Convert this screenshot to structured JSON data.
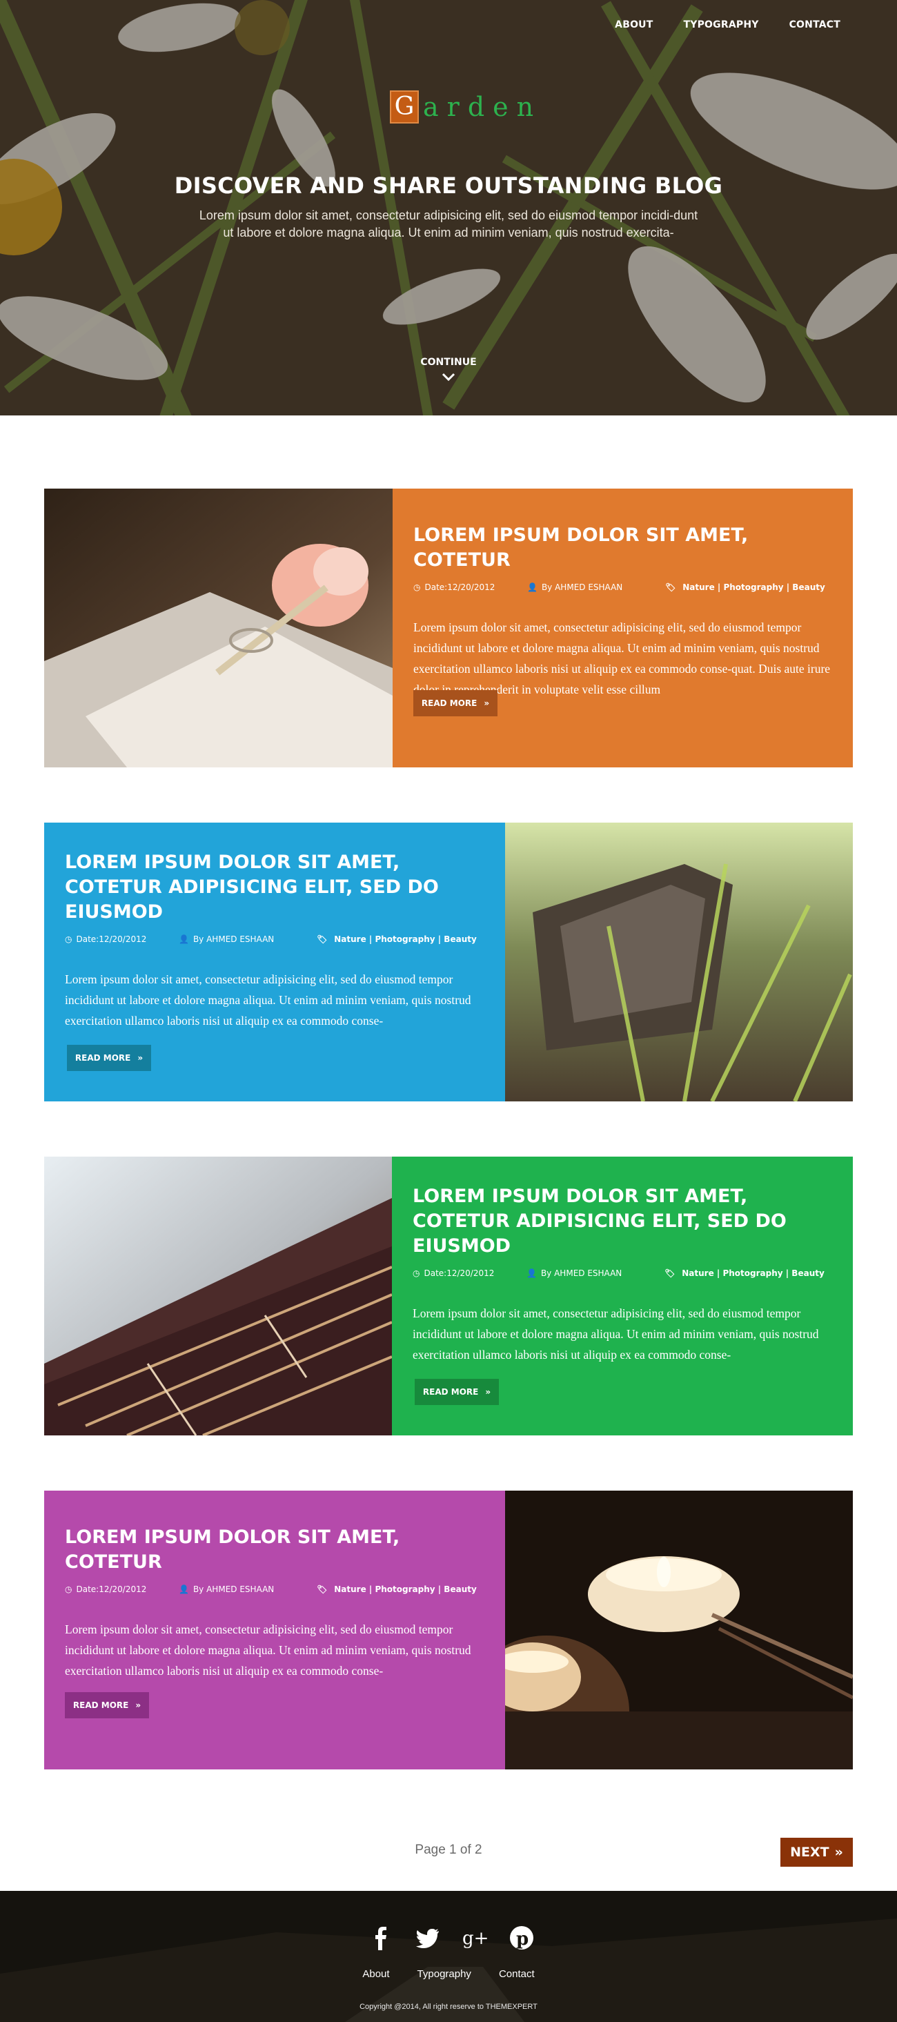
{
  "nav": {
    "items": [
      "ABOUT",
      "TYPOGRAPHY",
      "CONTACT"
    ]
  },
  "logo": {
    "first_letter": "G",
    "rest": "arden"
  },
  "hero": {
    "title": "DISCOVER AND SHARE OUTSTANDING BLOG",
    "subtitle": "Lorem ipsum dolor sit amet, consectetur adipisicing elit, sed do eiusmod tempor incidi-dunt ut labore et dolore magna aliqua. Ut enim ad minim veniam, quis nostrud exercita-",
    "continue": "CONTINUE"
  },
  "colors": {
    "orange": "#e07a2e",
    "blue": "#22a4d9",
    "green": "#1fb24e",
    "purple": "#b54aab",
    "next_button": "#8a3208",
    "logo_box": "#c45c14",
    "logo_text": "#2db24e"
  },
  "posts": [
    {
      "title": "LOREM IPSUM DOLOR SIT AMET, COTETUR",
      "date": "Date:12/20/2012",
      "author": "By AHMED ESHAAN",
      "categories": "Nature | Photography | Beauty",
      "excerpt": "Lorem ipsum dolor sit amet, consectetur adipisicing elit, sed do eiusmod tempor incididunt ut labore et dolore magna aliqua. Ut enim ad minim veniam, quis nostrud exercitation ullamco laboris nisi ut aliquip ex ea commodo conse-quat. Duis aute irure dolor in reprehenderit in voluptate velit esse cillum",
      "read_more": "READ MORE"
    },
    {
      "title": "LOREM IPSUM DOLOR SIT AMET, COTETUR ADIPISICING ELIT, SED DO EIUSMOD",
      "date": "Date:12/20/2012",
      "author": "By AHMED ESHAAN",
      "categories": "Nature | Photography | Beauty",
      "excerpt": "Lorem ipsum dolor sit amet, consectetur adipisicing elit, sed do eiusmod tempor incididunt ut labore et dolore magna aliqua. Ut enim ad minim veniam, quis nostrud exercitation ullamco laboris nisi ut aliquip ex ea commodo conse-",
      "read_more": "READ MORE"
    },
    {
      "title": "LOREM IPSUM DOLOR SIT AMET, COTETUR ADIPISICING ELIT, SED DO EIUSMOD",
      "date": "Date:12/20/2012",
      "author": "By AHMED ESHAAN",
      "categories": "Nature | Photography | Beauty",
      "excerpt": "Lorem ipsum dolor sit amet, consectetur adipisicing elit, sed do eiusmod tempor incididunt ut labore et dolore magna aliqua. Ut enim ad minim veniam, quis nostrud exercitation ullamco laboris nisi ut aliquip ex ea commodo conse-",
      "read_more": "READ MORE"
    },
    {
      "title": "LOREM IPSUM DOLOR SIT AMET, COTETUR",
      "date": "Date:12/20/2012",
      "author": "By AHMED ESHAAN",
      "categories": "Nature | Photography | Beauty",
      "excerpt": "Lorem ipsum dolor sit amet, consectetur adipisicing elit, sed do eiusmod tempor incididunt ut labore et dolore magna aliqua. Ut enim ad minim veniam, quis nostrud exercitation ullamco laboris nisi ut aliquip ex ea commodo conse-",
      "read_more": "READ MORE"
    }
  ],
  "pagination": {
    "page_info": "Page 1 of 2",
    "next": "NEXT"
  },
  "footer": {
    "socials": [
      "facebook-icon",
      "twitter-icon",
      "google-plus-icon",
      "pinterest-icon"
    ],
    "links": [
      "About",
      "Typography",
      "Contact"
    ],
    "copyright": "Copyright @2014, All right reserve to THEMEXPERT"
  }
}
